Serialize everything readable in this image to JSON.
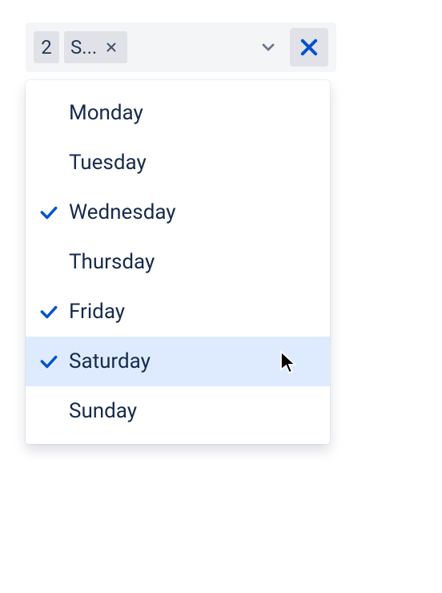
{
  "select": {
    "overflow_count": "2",
    "visible_chip_label": "S...",
    "options": [
      {
        "label": "Monday",
        "selected": false,
        "highlighted": false
      },
      {
        "label": "Tuesday",
        "selected": false,
        "highlighted": false
      },
      {
        "label": "Wednesday",
        "selected": true,
        "highlighted": false
      },
      {
        "label": "Thursday",
        "selected": false,
        "highlighted": false
      },
      {
        "label": "Friday",
        "selected": true,
        "highlighted": false
      },
      {
        "label": "Saturday",
        "selected": true,
        "highlighted": true
      },
      {
        "label": "Sunday",
        "selected": false,
        "highlighted": false
      }
    ]
  },
  "colors": {
    "accent": "#0052cc",
    "highlight_bg": "#deebff",
    "chip_bg": "#e0e2e7",
    "text": "#172b4d"
  }
}
